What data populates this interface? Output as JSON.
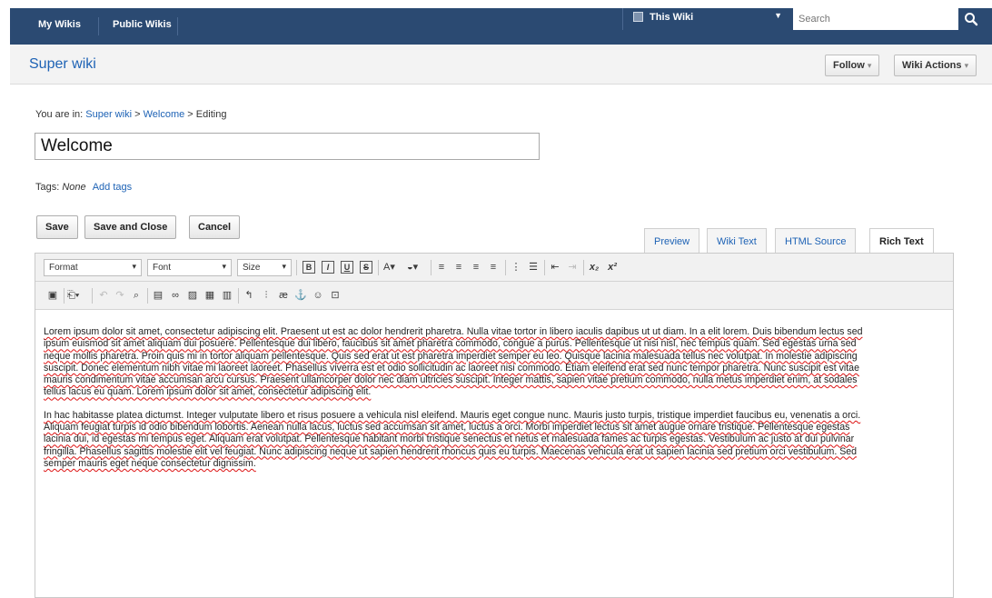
{
  "topbar": {
    "tabs": [
      "My Wikis",
      "Public Wikis"
    ],
    "scope_label": "This Wiki",
    "search_placeholder": "Search"
  },
  "header": {
    "wiki_title": "Super wiki",
    "follow_label": "Follow",
    "wiki_actions_label": "Wiki Actions"
  },
  "breadcrumb": {
    "prefix": "You are in:",
    "wiki": "Super wiki",
    "sep1": ">",
    "page": "Welcome",
    "sep2": ">",
    "current": "Editing"
  },
  "page_title_value": "Welcome",
  "tags": {
    "label": "Tags:",
    "value": "None",
    "add_link": "Add tags"
  },
  "actions": {
    "save": "Save",
    "save_close": "Save and Close",
    "cancel": "Cancel"
  },
  "editor_tabs": [
    "Preview",
    "Wiki Text",
    "HTML Source",
    "Rich Text"
  ],
  "active_editor_tab": "Rich Text",
  "toolbar": {
    "format": "Format",
    "font": "Font",
    "size": "Size"
  },
  "content": {
    "paragraphs": [
      "Lorem ipsum dolor sit amet, consectetur adipiscing elit. Praesent ut est ac dolor hendrerit pharetra. Nulla vitae tortor in libero iaculis dapibus ut ut diam. In a elit lorem. Duis bibendum lectus sed ipsum euismod sit amet aliquam dui posuere. Pellentesque dui libero, faucibus sit amet pharetra commodo, congue a purus. Pellentesque ut nisi nisl, nec tempus quam. Sed egestas urna sed neque mollis pharetra. Proin quis mi in tortor aliquam pellentesque. Quis sed erat ut est pharetra imperdiet semper eu leo. Quisque lacinia malesuada tellus nec volutpat. In molestie adipiscing suscipit. Donec elementum nibh vitae mi laoreet laoreet. Phasellus viverra est et odio sollicitudin ac laoreet nisi commodo. Etiam eleifend erat sed nunc tempor pharetra. Nunc suscipit est vitae mauris condimentum vitae accumsan arcu cursus. Praesent ullamcorper dolor nec diam ultricies suscipit. Integer mattis, sapien vitae pretium commodo, nulla metus imperdiet enim, at sodales tellus lacus eu quam. Lorem ipsum dolor sit amet, consectetur adipiscing elit.",
      "In hac habitasse platea dictumst. Integer vulputate libero et risus posuere a vehicula nisl eleifend. Mauris eget congue nunc. Mauris justo turpis, tristique imperdiet faucibus eu, venenatis a orci. Aliquam feugiat turpis id odio bibendum lobortis. Aenean nulla lacus, luctus sed accumsan sit amet, luctus a orci. Morbi imperdiet lectus sit amet augue ornare tristique. Pellentesque egestas lacinia dui, id egestas mi tempus eget. Aliquam erat volutpat. Pellentesque habitant morbi tristique senectus et netus et malesuada fames ac turpis egestas. Vestibulum ac justo at dui pulvinar fringilla. Phasellus sagittis molestie elit vel feugiat. Nunc adipiscing neque ut sapien hendrerit rhoncus quis eu turpis. Maecenas vehicula erat ut sapien lacinia sed pretium orci vestibulum. Sed semper mauris eget neque consectetur dignissim."
    ]
  }
}
